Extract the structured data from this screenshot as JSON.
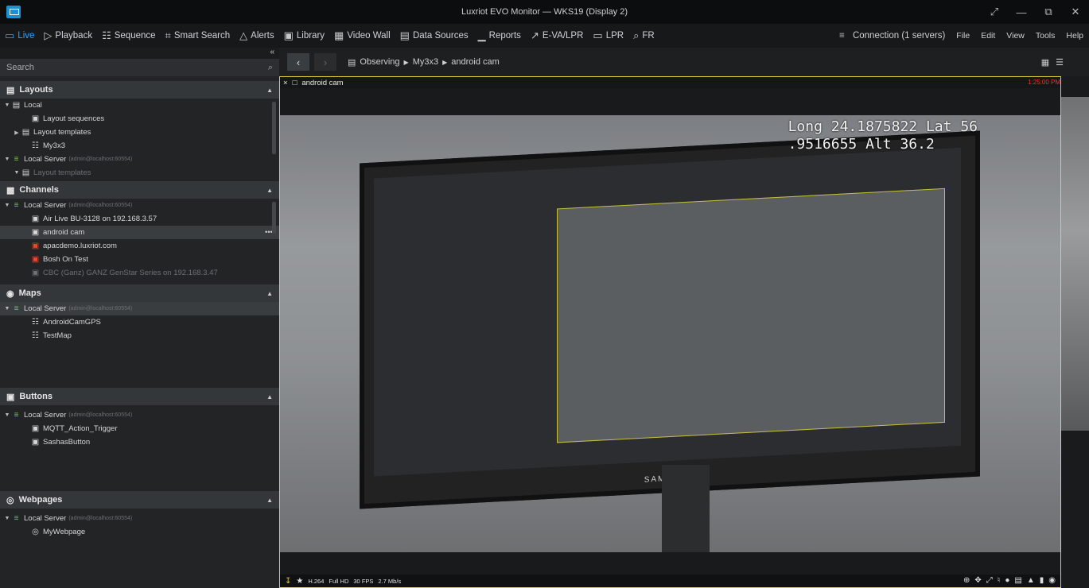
{
  "window": {
    "title": "Luxriot EVO Monitor — WKS19 (Display 2)",
    "controls": [
      "⤢",
      "—",
      "⧉",
      "✕"
    ]
  },
  "menu": {
    "tabs": [
      {
        "icon": "▭",
        "label": "Live",
        "icon_name": "live-icon"
      },
      {
        "icon": "▷",
        "label": "Playback",
        "icon_name": "playback-icon"
      },
      {
        "icon": "☷",
        "label": "Sequence",
        "icon_name": "sequence-icon"
      },
      {
        "icon": "⌗",
        "label": "Smart Search",
        "icon_name": "smart-search-icon"
      },
      {
        "icon": "△",
        "label": "Alerts",
        "icon_name": "alerts-icon"
      },
      {
        "icon": "▣",
        "label": "Library",
        "icon_name": "library-icon"
      },
      {
        "icon": "▦",
        "label": "Video Wall",
        "icon_name": "video-wall-icon"
      },
      {
        "icon": "▤",
        "label": "Data Sources",
        "icon_name": "data-sources-icon"
      },
      {
        "icon": "▁",
        "label": "Reports",
        "icon_name": "reports-icon"
      },
      {
        "icon": "↗",
        "label": "E-VA/LPR",
        "icon_name": "eva-lpr-icon"
      },
      {
        "icon": "▭",
        "label": "LPR",
        "icon_name": "lpr-icon"
      },
      {
        "icon": "⌕",
        "label": "FR",
        "icon_name": "fr-icon"
      }
    ],
    "connection": "Connection (1 servers)",
    "right_items": [
      "File",
      "Edit",
      "View",
      "Tools",
      "Help"
    ]
  },
  "sidebar": {
    "collapse": "«",
    "search_placeholder": "Search",
    "layouts": {
      "title": "Layouts",
      "items": [
        {
          "label": "Local",
          "indent": 0,
          "twisty": "▼",
          "icon": "▤"
        },
        {
          "label": "Layout sequences",
          "indent": 2,
          "twisty": "",
          "icon": "▣"
        },
        {
          "label": "Layout templates",
          "indent": 1,
          "twisty": "▶",
          "icon": "▤"
        },
        {
          "label": "My3x3",
          "indent": 2,
          "twisty": "",
          "icon": "☷"
        },
        {
          "label": "Local Server",
          "meta": "(admin@localhost:60554)",
          "indent": 0,
          "twisty": "▼",
          "icon": "≡"
        },
        {
          "label": "Layout templates",
          "indent": 1,
          "twisty": "▼",
          "icon": "▤",
          "dim": true
        }
      ]
    },
    "channels": {
      "title": "Channels",
      "items": [
        {
          "label": "Local Server",
          "meta": "(admin@localhost:60554)",
          "type": "server"
        },
        {
          "label": "Air Live BU-3128 on 192.168.3.57",
          "type": "cam"
        },
        {
          "label": "android cam",
          "type": "cam",
          "selected": true,
          "more": "•••"
        },
        {
          "label": "apacdemo.luxriot.com",
          "type": "cam-red"
        },
        {
          "label": "Bosh On Test",
          "type": "cam-red"
        },
        {
          "label": "CBC (Ganz) GANZ GenStar Series on 192.168.3.47",
          "type": "cam-dim"
        }
      ]
    },
    "maps": {
      "title": "Maps",
      "items": [
        {
          "label": "Local Server",
          "meta": "(admin@localhost:60554)",
          "type": "server",
          "selected": true
        },
        {
          "label": "AndroidCamGPS",
          "type": "map"
        },
        {
          "label": "TestMap",
          "type": "map"
        }
      ]
    },
    "buttons": {
      "title": "Buttons",
      "items": [
        {
          "label": "Local Server",
          "meta": "(admin@localhost:60554)",
          "type": "server"
        },
        {
          "label": "MQTT_Action_Trigger",
          "type": "button"
        },
        {
          "label": "SashasButton",
          "type": "button"
        }
      ]
    },
    "webpages": {
      "title": "Webpages",
      "items": [
        {
          "label": "Local Server",
          "meta": "(admin@localhost:60554)",
          "type": "server"
        },
        {
          "label": "MyWebpage",
          "type": "web"
        }
      ]
    }
  },
  "main": {
    "breadcrumb": [
      "Observing",
      "My3x3",
      "android cam"
    ],
    "crumb_sep": "▶",
    "tile": {
      "close": "×",
      "camera": "android cam",
      "timestamp": "1:25:00 PM",
      "overlay": "Long 24.1875822 Lat 56\n.9516655 Alt 36.2",
      "brand": "SAMSUNG",
      "codec": "H.264",
      "resolution": "Full HD",
      "fps": "30 FPS",
      "bitrate": "2.7 Mb/s"
    }
  },
  "colors": {
    "accent": "#2ea3ff",
    "server": "#7bc148",
    "frame": "#e1d236",
    "alert_cam": "#e34a2f"
  }
}
